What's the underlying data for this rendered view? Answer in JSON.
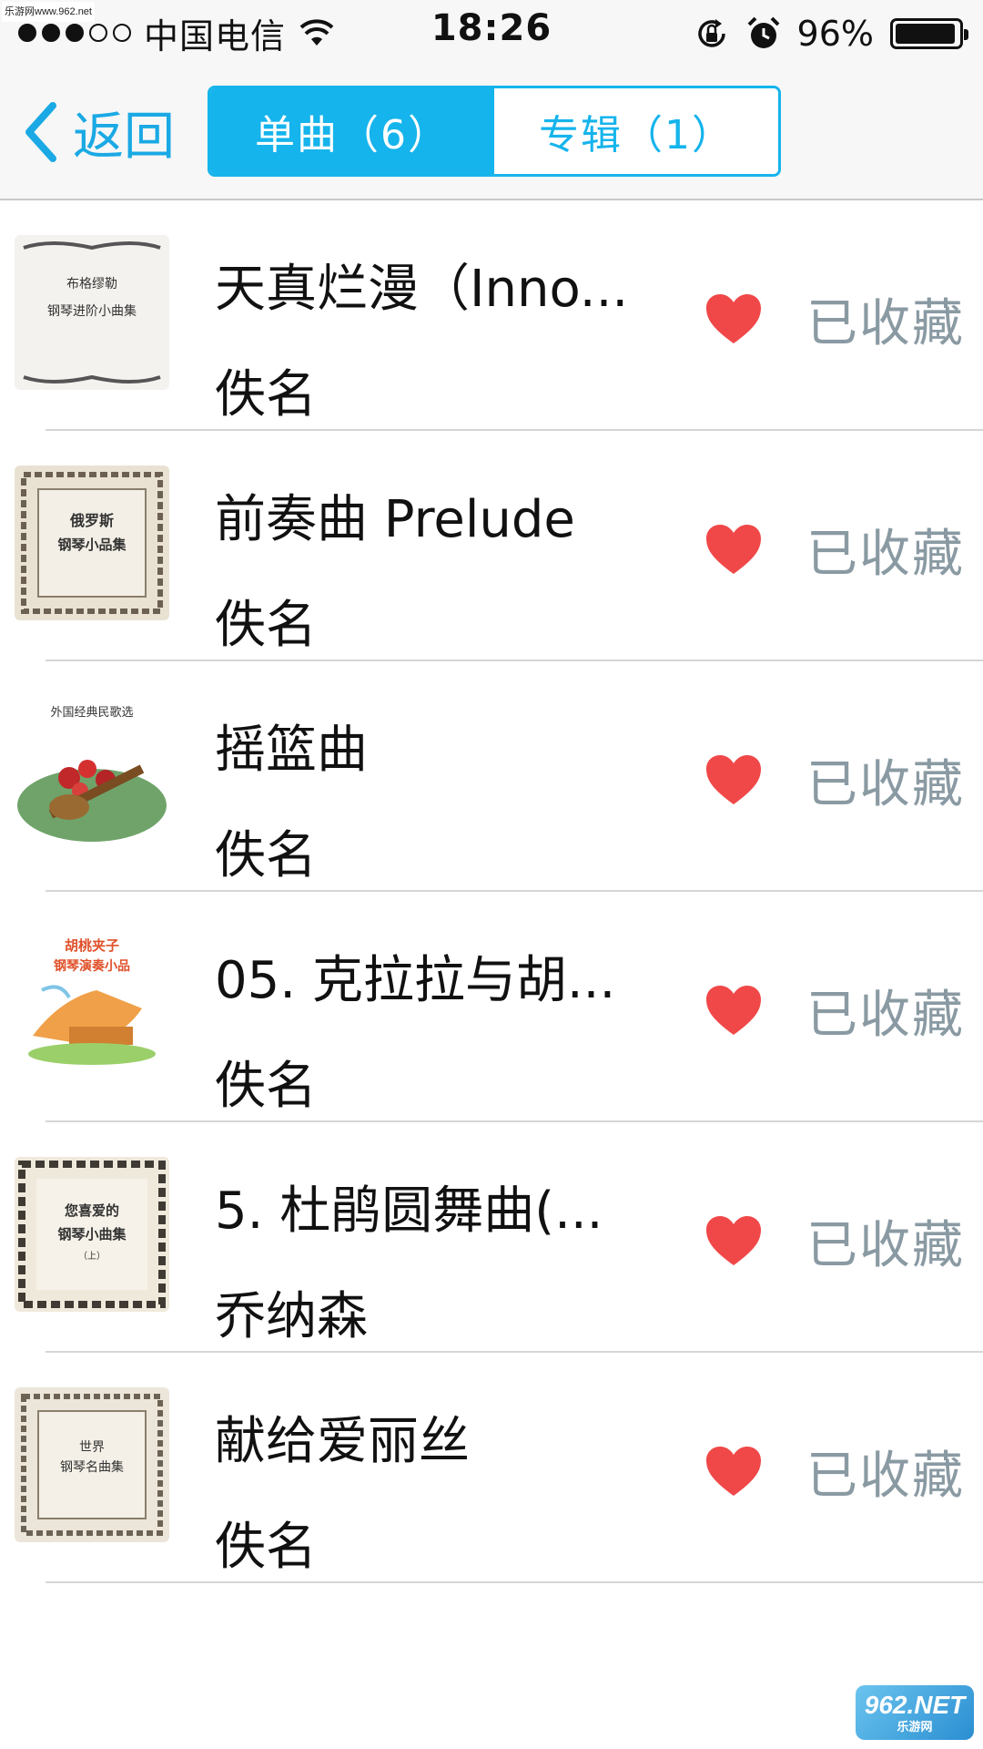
{
  "watermark_top": "乐游网www.962.net",
  "status_bar": {
    "carrier": "中国电信",
    "time": "18:26",
    "battery_percent": "96%",
    "battery_level": 0.96,
    "signal_bars": 3,
    "signal_total": 5,
    "icons": [
      "wifi-icon",
      "rotation-lock-icon",
      "alarm-icon",
      "battery-icon"
    ]
  },
  "nav": {
    "back_label": "返回",
    "tabs": [
      {
        "label": "单曲（6）",
        "active": true
      },
      {
        "label": "专辑（1）",
        "active": false
      }
    ]
  },
  "colors": {
    "accent": "#15b4ec",
    "back": "#1aa9e4",
    "heart": "#f04848",
    "muted": "#8a9aa3"
  },
  "songs": [
    {
      "title": "天真烂漫（Inno...",
      "artist": "佚名",
      "fav_label": "已收藏",
      "cover_text": [
        "布格缪勒",
        "钢琴进阶小曲集"
      ]
    },
    {
      "title": "前奏曲 Prelude",
      "artist": "佚名",
      "fav_label": "已收藏",
      "cover_text": [
        "俄罗斯",
        "钢琴小品集"
      ]
    },
    {
      "title": "摇篮曲",
      "artist": "佚名",
      "fav_label": "已收藏",
      "cover_text": [
        "外国经典民歌选"
      ]
    },
    {
      "title": "05. 克拉拉与胡...",
      "artist": "佚名",
      "fav_label": "已收藏",
      "cover_text": [
        "胡桃夹子",
        "钢琴演奏小品"
      ]
    },
    {
      "title": "5. 杜鹃圆舞曲(...",
      "artist": "乔纳森",
      "fav_label": "已收藏",
      "cover_text": [
        "您喜爱的",
        "钢琴小曲集",
        "（上）"
      ]
    },
    {
      "title": "献给爱丽丝",
      "artist": "佚名",
      "fav_label": "已收藏",
      "cover_text": [
        "世界",
        "钢琴名曲集"
      ]
    }
  ],
  "watermark_bottom": {
    "main": "962.NET",
    "sub": "乐游网"
  }
}
